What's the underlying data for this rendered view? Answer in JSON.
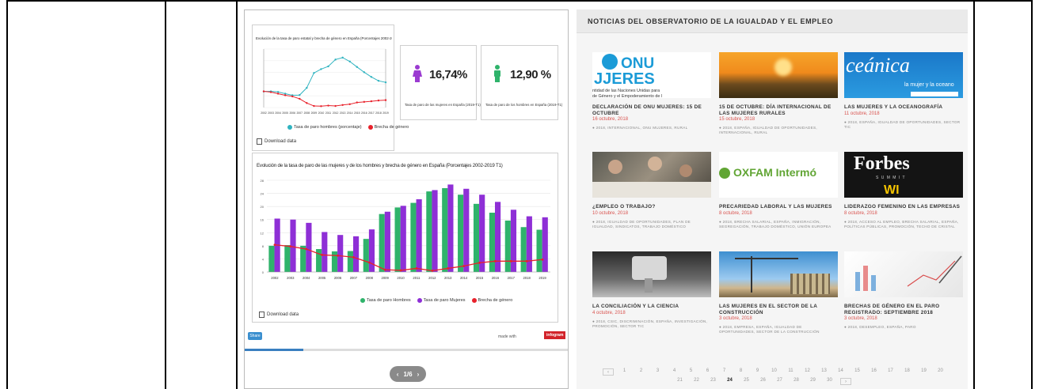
{
  "dashboard": {
    "line_card": {
      "title": "Evolución de la tasa de paro estatal y brecha de género en España (Porcentajes 2002-2019 T1)",
      "legend": [
        "Tasa de paro hombres (porcentaje)",
        "Brecha de género"
      ],
      "download": "Download data"
    },
    "kpi_women": {
      "value": "16,74%",
      "label": "Tasa de paro de las mujeres en España (2019-T1)",
      "color": "#9b3bd1"
    },
    "kpi_men": {
      "value": "12,90 %",
      "label": "Tasa de paro de los hombres en España (2019-T1)",
      "color": "#2fb36b"
    },
    "bar_card": {
      "title": "Evolución de la tasa de paro de las mujeres y de los hombres y brecha de género en España (Porcentajes 2002-2019 T1)",
      "legend": [
        "Tasa de paro Hombres",
        "Tasa de paro Mujeres",
        "Brecha de género"
      ],
      "download": "Download data"
    },
    "share_label": "Share",
    "made_with": "made with",
    "brand": "infogram",
    "pager": {
      "label": "1/6",
      "prev": "‹",
      "next": "›"
    },
    "progress": 0.18
  },
  "chart_data": [
    {
      "type": "line",
      "title": "Evolución de la tasa de paro estatal y brecha de género en España (Porcentajes 2002-2019 T1)",
      "x": [
        "2002",
        "2003",
        "2004",
        "2005",
        "2006",
        "2007",
        "2008",
        "2009",
        "2010",
        "2011",
        "2012",
        "2013",
        "2014",
        "2015",
        "2016",
        "2017",
        "2018",
        "2019"
      ],
      "series": [
        {
          "name": "Tasa de paro hombres (porcentaje)",
          "color": "#2fb3c0",
          "values": [
            8.2,
            8.3,
            8.0,
            7.1,
            6.3,
            6.4,
            10.1,
            17.7,
            19.7,
            21.1,
            24.6,
            25.6,
            23.6,
            20.8,
            18.1,
            15.7,
            13.7,
            12.9
          ]
        },
        {
          "name": "Brecha de género",
          "color": "#e8212b",
          "values": [
            8.3,
            7.9,
            7.1,
            6.3,
            5.7,
            4.5,
            2.3,
            0.8,
            0.7,
            1.0,
            0.8,
            1.3,
            1.7,
            2.6,
            2.9,
            3.2,
            3.6,
            3.8
          ]
        }
      ]
    },
    {
      "type": "bar",
      "title": "Evolución de la tasa de paro de las mujeres y de los hombres y brecha de género en España (Porcentajes 2002-2019 T1)",
      "categories": [
        "2002",
        "2003",
        "2004",
        "2005",
        "2006",
        "2007",
        "2008",
        "2009",
        "2010",
        "2011",
        "2012",
        "2013",
        "2014",
        "2015",
        "2016",
        "2017",
        "2018",
        "2019"
      ],
      "series": [
        {
          "name": "Tasa de paro Hombres",
          "color": "#2fb36b",
          "values": [
            8.0,
            8.2,
            8.0,
            7.0,
            6.3,
            6.4,
            10.1,
            17.7,
            19.7,
            21.1,
            24.6,
            25.6,
            23.6,
            20.8,
            18.1,
            15.7,
            13.7,
            12.9
          ]
        },
        {
          "name": "Tasa de paro Mujeres",
          "color": "#8e2fd6",
          "values": [
            16.3,
            16.0,
            15.0,
            12.2,
            11.3,
            10.9,
            13.0,
            18.4,
            20.2,
            22.2,
            25.0,
            26.7,
            25.4,
            23.6,
            21.4,
            19.0,
            17.0,
            16.7
          ]
        },
        {
          "name": "Brecha de género",
          "color": "#e8212b",
          "values": [
            8.3,
            7.8,
            7.0,
            5.2,
            5.0,
            4.5,
            2.9,
            0.7,
            0.5,
            1.1,
            0.4,
            1.1,
            1.8,
            2.8,
            3.3,
            3.3,
            3.3,
            3.8
          ]
        }
      ],
      "ylim": [
        0,
        28
      ]
    }
  ],
  "news": {
    "header": "NOTICIAS DEL OBSERVATORIO DE LA IGUALDAD Y EL EMPLEO",
    "items": [
      {
        "title": "DECLARACIÓN DE ONU MUJERES: 15 DE OCTUBRE",
        "date": "16 octubre, 2018",
        "tags": "2018, INTERNACIONAL, ONU MUJERES, RURAL",
        "thumb": "onu",
        "thumb_text": [
          "ONU",
          "JJERES",
          "ntidad de las Naciones Unidas para",
          "de Género y el Empoderamiento de l"
        ]
      },
      {
        "title": "15 DE OCTUBRE: DÍA INTERNACIONAL DE LAS MUJERES RURALES",
        "date": "15 octubre, 2018",
        "tags": "2018, ESPAÑA, IGUALDAD DE OPORTUNIDADES, INTERNACIONAL, RURAL",
        "thumb": "sunset"
      },
      {
        "title": "LAS MUJERES Y LA OCEANOGRAFÍA",
        "date": "11 octubre, 2018",
        "tags": "2018, ESPAÑA, IGUALDAD DE OPORTUNIDADES, SECTOR TIC",
        "thumb": "ocean",
        "thumb_text": [
          "ceánica",
          "la mujer y la oceano"
        ]
      },
      {
        "title": "¿EMPLEO O TRABAJO?",
        "date": "10 octubre, 2018",
        "tags": "2018, IGUALDAD DE OPORTUNIDADES, PLAN DE IGUALDAD, SINDICATOS, TRABAJO DOMÉSTICO",
        "thumb": "people"
      },
      {
        "title": "PRECARIEDAD LABORAL Y LAS MUJERES",
        "date": "8 octubre, 2018",
        "tags": "2018, BRECHA SALARIAL, ESPAÑA, INMIGRACIÓN, SEGREGACIÓN, TRABAJO DOMÉSTICO, UNIÓN EUROPEA",
        "thumb": "oxfam",
        "thumb_text": [
          "OXFAM Intermó"
        ]
      },
      {
        "title": "LIDERAZGO FEMENINO EN LAS EMPRESAS",
        "date": "8 octubre, 2018",
        "tags": "2018, ACCESO AL EMPLEO, BRECHA SALARIAL, ESPAÑA, POLÍTICAS PÚBLICAS, PROMOCIÓN, TECHO DE CRISTAL",
        "thumb": "forbes",
        "thumb_text": [
          "Forbes",
          "S U M M I T",
          "WI"
        ]
      },
      {
        "title": "LA CONCILIACIÓN Y LA CIENCIA",
        "date": "4 octubre, 2018",
        "tags": "2018, CSIC, DISCRIMINACIÓN, ESPAÑA, INVESTIGACIÓN, PROMOCIÓN, SECTOR TIC",
        "thumb": "micro"
      },
      {
        "title": "LAS MUJERES EN EL SECTOR DE LA CONSTRUCCIÓN",
        "date": "3 octubre, 2018",
        "tags": "2018, EMPRESA, ESPAÑA, IGUALDAD DE OPORTUNIDADES, SECTOR DE LA CONSTRUCCIÓN",
        "thumb": "crane"
      },
      {
        "title": "BRECHAS DE GÉNERO EN EL PARO REGISTRADO: SEPTIEMBRE 2018",
        "date": "3 octubre, 2018",
        "tags": "2018, DESEMPLEO, ESPAÑA, PARO",
        "thumb": "charts"
      }
    ],
    "pagination": {
      "prev": "‹",
      "next": "›",
      "row1": [
        "1",
        "2",
        "3",
        "4",
        "5",
        "6",
        "7",
        "8",
        "9",
        "10",
        "11",
        "12",
        "13",
        "14",
        "15",
        "16",
        "17",
        "18",
        "19",
        "20"
      ],
      "row2": [
        "21",
        "22",
        "23",
        "24",
        "25",
        "26",
        "27",
        "28",
        "29",
        "30"
      ],
      "current": "24"
    }
  }
}
